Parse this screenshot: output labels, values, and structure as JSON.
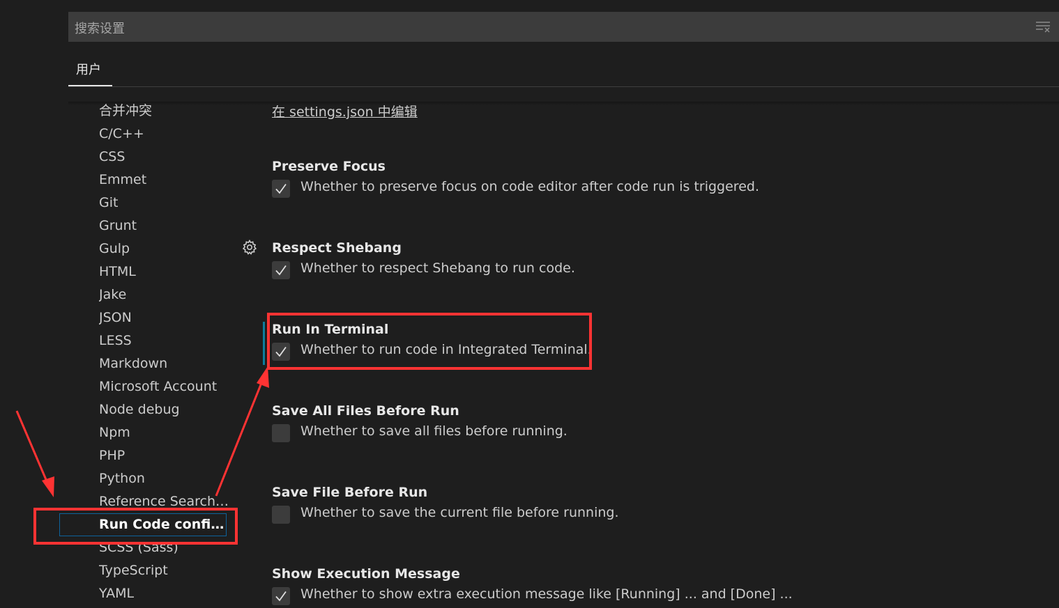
{
  "search": {
    "placeholder": "搜索设置"
  },
  "tabs": [
    {
      "label": "用户"
    }
  ],
  "toc": {
    "items": [
      {
        "label": "合并冲突",
        "active": false
      },
      {
        "label": "C/C++",
        "active": false
      },
      {
        "label": "CSS",
        "active": false
      },
      {
        "label": "Emmet",
        "active": false
      },
      {
        "label": "Git",
        "active": false
      },
      {
        "label": "Grunt",
        "active": false
      },
      {
        "label": "Gulp",
        "active": false
      },
      {
        "label": "HTML",
        "active": false
      },
      {
        "label": "Jake",
        "active": false
      },
      {
        "label": "JSON",
        "active": false
      },
      {
        "label": "LESS",
        "active": false
      },
      {
        "label": "Markdown",
        "active": false
      },
      {
        "label": "Microsoft Account",
        "active": false
      },
      {
        "label": "Node debug",
        "active": false
      },
      {
        "label": "Npm",
        "active": false
      },
      {
        "label": "PHP",
        "active": false
      },
      {
        "label": "Python",
        "active": false
      },
      {
        "label": "Reference Search V...",
        "active": false
      },
      {
        "label": "Run Code configu...",
        "active": true
      },
      {
        "label": "SCSS (Sass)",
        "active": false
      },
      {
        "label": "TypeScript",
        "active": false
      },
      {
        "label": "YAML",
        "active": false
      }
    ]
  },
  "main": {
    "edit_link": "在 settings.json 中编辑",
    "settings": [
      {
        "title": "Preserve Focus",
        "description": "Whether to preserve focus on code editor after code run is triggered.",
        "checked": true
      },
      {
        "title": "Respect Shebang",
        "description": "Whether to respect Shebang to run code.",
        "checked": true
      },
      {
        "title": "Run In Terminal",
        "description": "Whether to run code in Integrated Terminal.",
        "checked": true
      },
      {
        "title": "Save All Files Before Run",
        "description": "Whether to save all files before running.",
        "checked": false
      },
      {
        "title": "Save File Before Run",
        "description": "Whether to save the current file before running.",
        "checked": false
      },
      {
        "title": "Show Execution Message",
        "description": "Whether to show extra execution message like [Running] ... and [Done] ...",
        "checked": true
      }
    ]
  },
  "colors": {
    "background": "#1e1e1e",
    "input_background": "#3c3c3c",
    "annotation": "#ff3333",
    "modified_indicator": "#0c7d9d"
  }
}
